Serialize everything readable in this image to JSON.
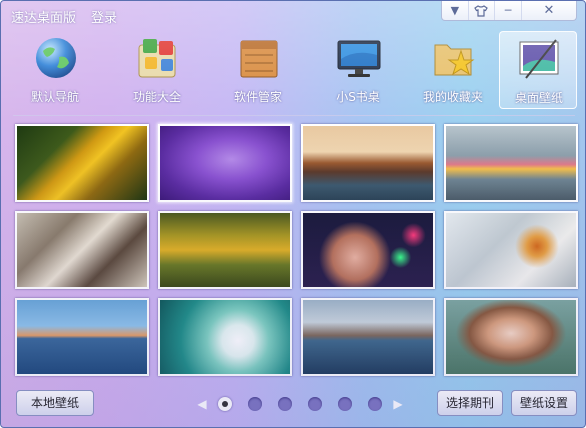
{
  "titlebar": {
    "title": "速达桌面版",
    "login": "登录"
  },
  "window_controls": [
    "▼",
    "👕",
    "─",
    "✕"
  ],
  "tools": [
    {
      "label": "默认导航",
      "icon": "globe-icon"
    },
    {
      "label": "功能大全",
      "icon": "apps-icon"
    },
    {
      "label": "软件管家",
      "icon": "box-icon"
    },
    {
      "label": "小S书桌",
      "icon": "monitor-icon"
    },
    {
      "label": "我的收藏夹",
      "icon": "star-folder-icon"
    },
    {
      "label": "桌面壁纸",
      "icon": "wallpaper-icon",
      "active": true
    }
  ],
  "wallpapers": [
    "yellow-crocus-flowers",
    "purple-rose",
    "sea-cliff-sunset",
    "candy-bowl",
    "books-collage",
    "autumn-forest-road",
    "cup-bokeh-lights",
    "fence-autumn-leaf",
    "ocean-boat-dusk",
    "dandelion-seeds",
    "coastal-cliffs",
    "girl-straw-hat"
  ],
  "footer": {
    "local_wallpaper": "本地壁纸",
    "select_issue": "选择期刊",
    "wallpaper_settings": "壁纸设置"
  },
  "pager": {
    "pages": 6,
    "current": 1
  }
}
